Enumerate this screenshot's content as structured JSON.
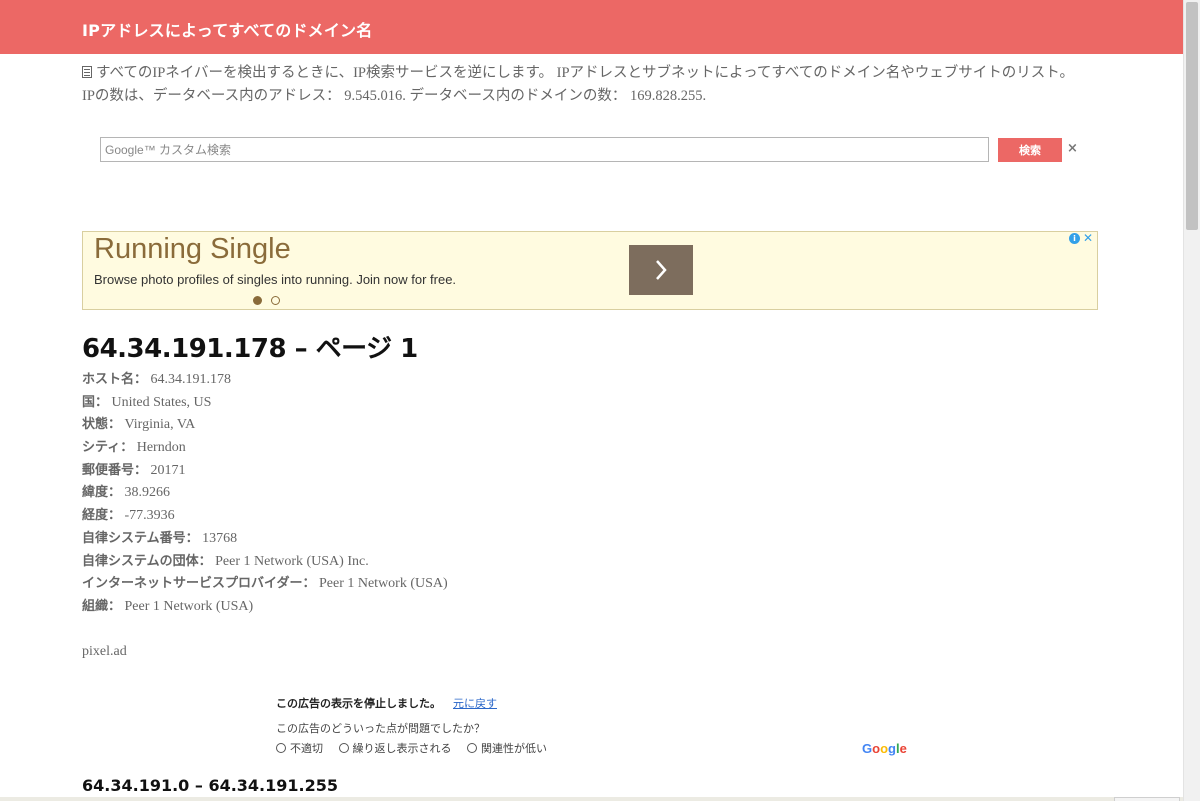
{
  "site": {
    "title": "IPアドレスによってすべてのドメイン名"
  },
  "intro": {
    "text": "すべてのIPネイバーを検出するときに、IP検索サービスを逆にします。 IPアドレスとサブネットによってすべてのドメイン名やウェブサイトのリスト。 IPの数は、データベース内のアドレス： 9.545.016. データベース内のドメインの数： 169.828.255."
  },
  "search": {
    "placeholder": "Google™ カスタム検索",
    "button_label": "検索",
    "clear_symbol": "×"
  },
  "ad": {
    "title": "Running Single",
    "text": "Browse photo profiles of singles into running. Join now for free.",
    "info_symbol": "i",
    "close_symbol": "✕"
  },
  "page": {
    "heading": "64.34.191.178 – ページ 1"
  },
  "details": [
    {
      "label": "ホスト名：",
      "value": "64.34.191.178"
    },
    {
      "label": "国：",
      "value": "United States, US"
    },
    {
      "label": "状態：",
      "value": "Virginia, VA"
    },
    {
      "label": "シティ：",
      "value": "Herndon"
    },
    {
      "label": "郵便番号：",
      "value": "20171"
    },
    {
      "label": "緯度：",
      "value": "38.9266"
    },
    {
      "label": "経度：",
      "value": "-77.3936"
    },
    {
      "label": "自律システム番号：",
      "value": "13768"
    },
    {
      "label": "自律システムの団体：",
      "value": "Peer 1 Network (USA) Inc."
    },
    {
      "label": "インターネットサービスプロバイダー：",
      "value": "Peer 1 Network (USA)"
    },
    {
      "label": "組織：",
      "value": "Peer 1 Network (USA)"
    }
  ],
  "pixel_ad": {
    "text": "pixel.ad"
  },
  "ad_closed": {
    "stopped_text": "この広告の表示を停止しました。",
    "undo_link": "元に戻す",
    "question": "この広告のどういった点が問題でしたか？",
    "options": [
      "不適切",
      "繰り返し表示される",
      "関連性が低い"
    ],
    "google_label": "Google"
  },
  "subnet": {
    "heading": "64.34.191.0 – 64.34.191.255"
  },
  "icons": {
    "doc": "document-icon",
    "search_clear": "close-icon",
    "ad_next": "chevron-right-icon",
    "ad_info": "info-icon",
    "ad_close": "close-icon"
  },
  "colors": {
    "brand": "#ec6865",
    "ad_background": "#fffbe0",
    "ad_title": "#8a6b3a",
    "ad_arrow": "#7d6d5d",
    "link": "#2a67c9"
  }
}
